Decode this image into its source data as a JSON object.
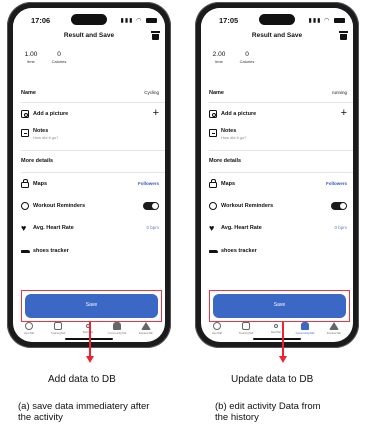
{
  "left": {
    "time": "17:06",
    "title": "Result and Save",
    "stat_time_value": "1.00",
    "stat_time_label": "time",
    "stat_cal_value": "0",
    "stat_cal_label": "Calories",
    "name_label": "Name",
    "name_value": "Cycling",
    "picture_label": "Add a picture",
    "plus": "+",
    "notes_label": "Notes",
    "notes_placeholder": "How did it go?",
    "more_details": "More details",
    "maps_label": "Maps",
    "maps_value": "Followers",
    "reminders_label": "Workout Reminders",
    "heart_label": "Avg. Heart Rate",
    "heart_value": "0 bpm",
    "shoes_label": "shoes tracker",
    "save": "Save",
    "tabs": [
      "UserTab",
      "TrainingTab",
      "StartTab",
      "CommunityTab",
      "ExploreTab"
    ]
  },
  "right": {
    "time": "17:05",
    "title": "Result and Save",
    "stat_time_value": "2.00",
    "stat_time_label": "time",
    "stat_cal_value": "0",
    "stat_cal_label": "Calories",
    "name_label": "Name",
    "name_value": "running",
    "picture_label": "Add a picture",
    "plus": "+",
    "notes_label": "Notes",
    "notes_placeholder": "How did it go?",
    "more_details": "More details",
    "maps_label": "Maps",
    "maps_value": "Followers",
    "reminders_label": "Workout Reminders",
    "heart_label": "Avg. Heart Rate",
    "heart_value": "0 bpm",
    "shoes_label": "shoes tracker",
    "save": "Save",
    "tabs": [
      "UserTab",
      "TrainingTab",
      "StartTab",
      "CommunityTab",
      "ExploreTab"
    ]
  },
  "captions": {
    "left_action": "Add data to DB",
    "right_action": "Update data to DB",
    "left_sub_1": "(a) save data immediatery after",
    "left_sub_2": "the activity",
    "right_sub_1": "(b) edit activity Data from",
    "right_sub_2": "the history"
  },
  "colors": {
    "accent": "#3a68c4",
    "highlight": "#e23333"
  },
  "icons": [
    "trash-icon",
    "camera-icon",
    "notes-icon",
    "lock-icon",
    "alarm-icon",
    "heart-icon",
    "shoe-icon",
    "toggle"
  ]
}
